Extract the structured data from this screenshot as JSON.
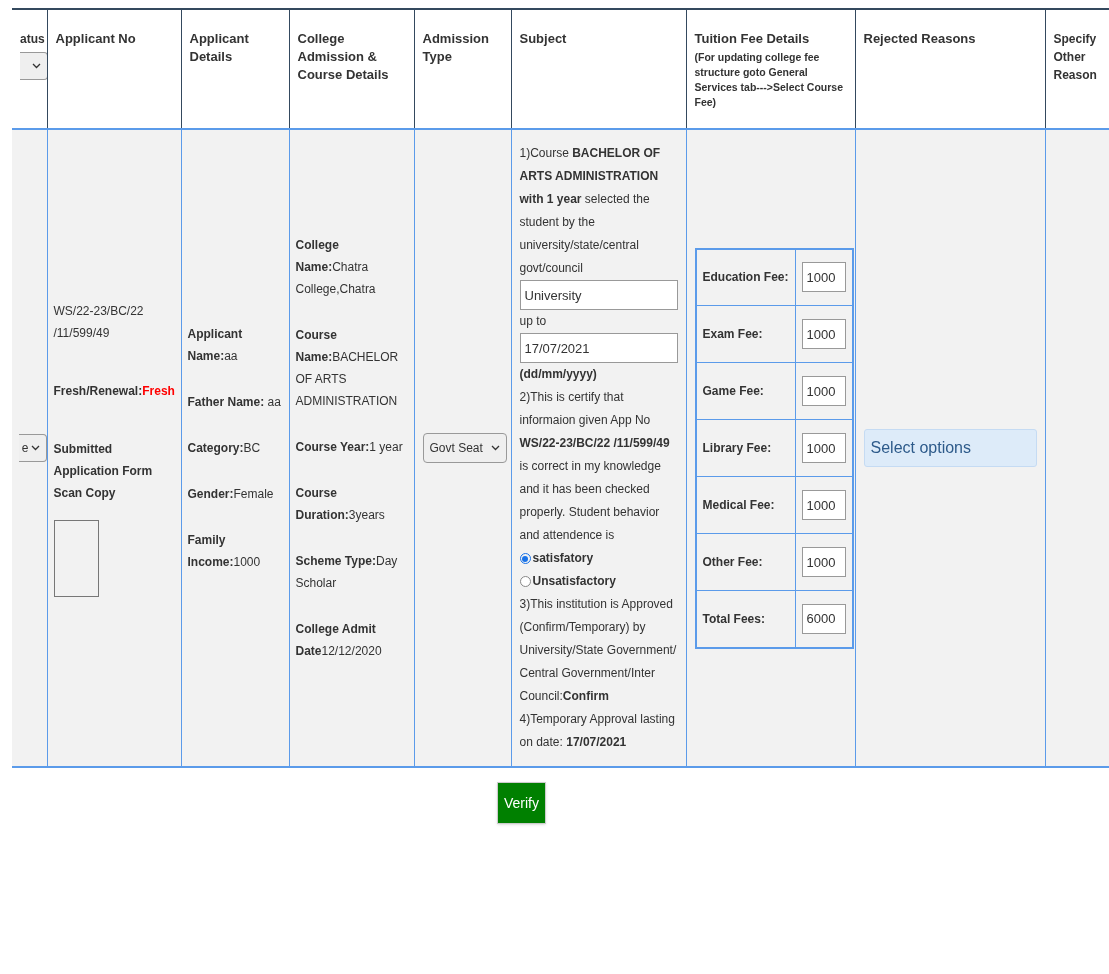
{
  "table": {
    "columns": [
      {
        "label": "atus",
        "kind": "select"
      },
      {
        "label": "Applicant No",
        "kind": "text"
      },
      {
        "label": "Applicant Details",
        "kind": "text"
      },
      {
        "label": "College Admission & Course Details",
        "kind": "text"
      },
      {
        "label": "Admission Type",
        "kind": "text"
      },
      {
        "label": "Subject",
        "kind": "text"
      },
      {
        "label": "Tuition Fee Details",
        "kind": "text",
        "note": "(For updating college fee structure goto General Services tab--->Select Course Fee)"
      },
      {
        "label": "Rejected Reasons",
        "kind": "text"
      },
      {
        "label": "Specify Other Reason",
        "kind": "text"
      }
    ],
    "row": {
      "status_select": {
        "value": "e"
      },
      "applicant_no": {
        "number": "WS/22-23/BC/22 /11/599/49",
        "fresh_renewal_label": "Fresh/Renewal:",
        "fresh_renewal_value": "Fresh",
        "scan_label": "Submitted Application Form Scan Copy"
      },
      "applicant_details": [
        "**Applicant Name:**aa",
        "**Father Name:** aa",
        "**Category:**BC",
        "**Gender:**Female",
        "**Family Income:**1000"
      ],
      "college_details": [
        "**College Name:**Chatra College,Chatra",
        "**Course Name:**BACHELOR OF ARTS ADMINISTRATION",
        "**Course Year:**1 year",
        "**Course Duration:**3years",
        "**Scheme Type:**Day Scholar",
        "**College Admit Date**12/12/2020"
      ],
      "admission_type": {
        "value": "Govt Seat"
      },
      "subject": [
        {
          "kind": "text",
          "text": "1)Course **BACHELOR OF ARTS ADMINISTRATION with 1 year** selected the student by the university/state/central govt/council"
        },
        {
          "kind": "input",
          "value": "University"
        },
        {
          "kind": "text",
          "text": "up to"
        },
        {
          "kind": "input",
          "value": "17/07/2021"
        },
        {
          "kind": "bold_text",
          "text": "(dd/mm/yyyy)"
        },
        {
          "kind": "text",
          "text": "2)This is certify that informaion given App No **WS/22-23/BC/22 /11/599/49** is correct in my knowledge and it has been checked properly. Student behavior and attendence is"
        },
        {
          "kind": "radio",
          "label": "satisfatory",
          "selected": true
        },
        {
          "kind": "radio",
          "label": "Unsatisfactory",
          "selected": false
        },
        {
          "kind": "text",
          "text": "3)This institution is Approved (Confirm/Temporary) by University/State Government/"
        },
        {
          "kind": "text",
          "text": "Central Government/Inter Council:**Confirm**"
        },
        {
          "kind": "text",
          "text": "4)Temporary Approval lasting on date: **17/07/2021**"
        }
      ],
      "fees": [
        {
          "label": "Education Fee:",
          "value": "1000"
        },
        {
          "label": "Exam Fee:",
          "value": "1000"
        },
        {
          "label": "Game Fee:",
          "value": "1000"
        },
        {
          "label": "Library Fee:",
          "value": "1000"
        },
        {
          "label": "Medical Fee:",
          "value": "1000"
        },
        {
          "label": "Other Fee:",
          "value": "1000"
        },
        {
          "label": "Total Fees:",
          "value": "6000"
        }
      ],
      "rejected_reasons": {
        "placeholder": "Select options"
      }
    }
  },
  "verify_button": {
    "label": "Verify"
  }
}
